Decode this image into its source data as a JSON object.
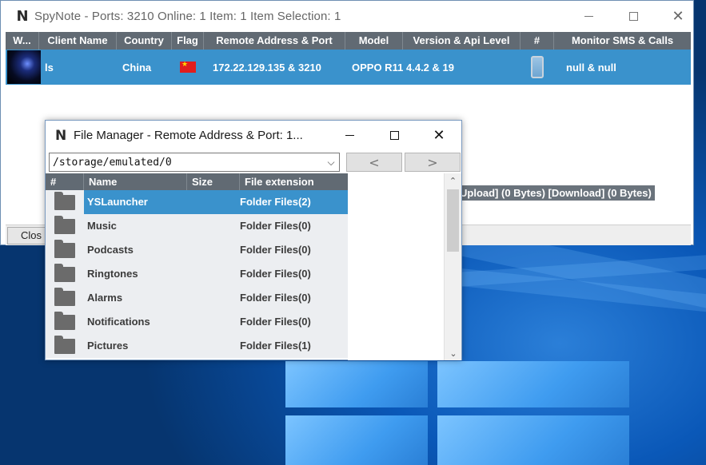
{
  "main_window": {
    "title": "SpyNote - Ports: 3210 Online: 1 Item: 1 Item Selection: 1",
    "columns": [
      "W...",
      "Client Name",
      "Country",
      "Flag",
      "Remote Address & Port",
      "Model",
      "Version & Api Level",
      "#",
      "Monitor SMS & Calls"
    ],
    "client": {
      "name": "ls",
      "country": "China",
      "remote": "172.22.129.135 & 3210",
      "model": "OPPO R11",
      "version": "4.4.2 & 19",
      "monitor": "null & null"
    },
    "status_text": "Upload] (0 Bytes) [Download] (0 Bytes)",
    "close_label": "Clos"
  },
  "file_manager": {
    "title": "File Manager - Remote Address & Port: 1...",
    "path": "/storage/emulated/0",
    "nav_back": "<",
    "nav_forward": ">",
    "columns": [
      "#",
      "Name",
      "Size",
      "File extension"
    ],
    "rows": [
      {
        "name": "YSLauncher",
        "size": "",
        "ext": "Folder Files(2)"
      },
      {
        "name": "Music",
        "size": "",
        "ext": "Folder Files(0)"
      },
      {
        "name": "Podcasts",
        "size": "",
        "ext": "Folder Files(0)"
      },
      {
        "name": "Ringtones",
        "size": "",
        "ext": "Folder Files(0)"
      },
      {
        "name": "Alarms",
        "size": "",
        "ext": "Folder Files(0)"
      },
      {
        "name": "Notifications",
        "size": "",
        "ext": "Folder Files(0)"
      },
      {
        "name": "Pictures",
        "size": "",
        "ext": "Folder Files(1)"
      }
    ],
    "selected_index": 0
  },
  "icons": {
    "app_logo": "spynote-logo-icon",
    "folder": "folder-icon",
    "phone": "phone-icon",
    "flag": "china-flag-icon"
  },
  "colors": {
    "header_bg": "#616a73",
    "selection_bg": "#3a92cc",
    "row_bg": "#eceef1",
    "desktop_blue": "#0a58b8"
  }
}
